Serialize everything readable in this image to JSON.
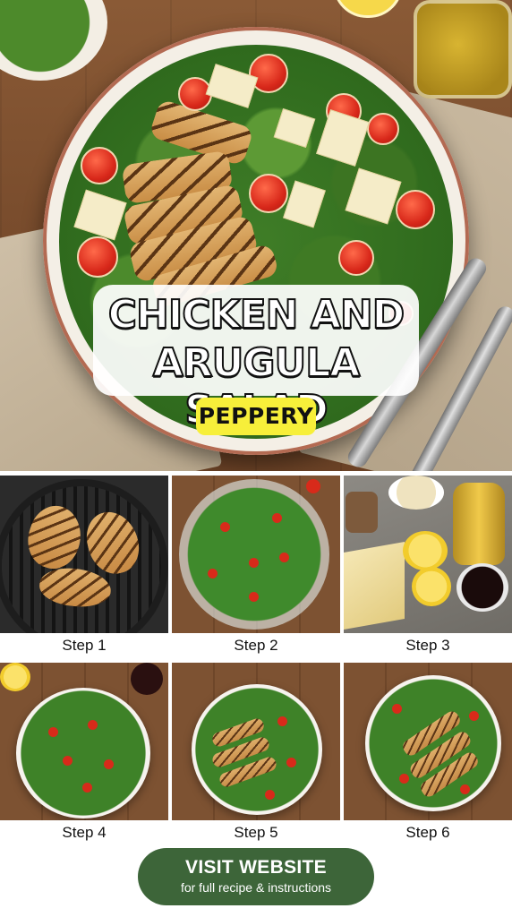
{
  "hero": {
    "title_line1": "CHICKEN AND",
    "title_line2": "ARUGULA SALAD",
    "tag": "PEPPERY"
  },
  "steps": [
    {
      "label": "Step 1"
    },
    {
      "label": "Step 2"
    },
    {
      "label": "Step 3"
    },
    {
      "label": "Step 4"
    },
    {
      "label": "Step 5"
    },
    {
      "label": "Step 6"
    }
  ],
  "cta": {
    "title": "VISIT WEBSITE",
    "subtitle": "for full recipe & instructions"
  },
  "colors": {
    "cta_background": "#3d6539",
    "tag_background": "#f7ef3a",
    "title_fill": "#ffffff",
    "title_outline": "#111111"
  }
}
